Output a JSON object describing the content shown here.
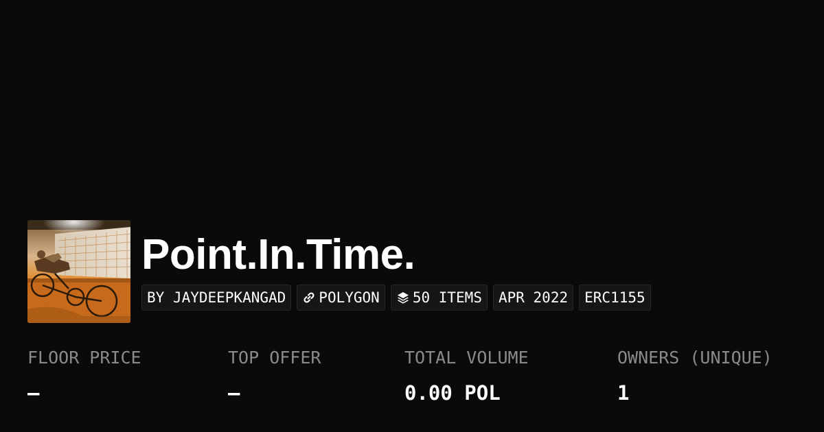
{
  "collection": {
    "title": "Point.In.Time.",
    "creator": "BY JAYDEEPKANGAD",
    "chain": "POLYGON",
    "items": "50 ITEMS",
    "date": "APR 2022",
    "standard": "ERC1155",
    "chain_icon": "link-icon",
    "items_icon": "stack-layers-icon"
  },
  "stats": [
    {
      "label": "FLOOR PRICE",
      "value": "–"
    },
    {
      "label": "TOP OFFER",
      "value": "–"
    },
    {
      "label": "TOTAL VOLUME",
      "value": "0.00 POL"
    },
    {
      "label": "OWNERS (UNIQUE)",
      "value": "1"
    }
  ],
  "colors": {
    "background": "#0a0a0a",
    "tag_background": "#161616",
    "tag_border": "#262626",
    "label": "#8a8a8a",
    "text": "#ffffff"
  }
}
